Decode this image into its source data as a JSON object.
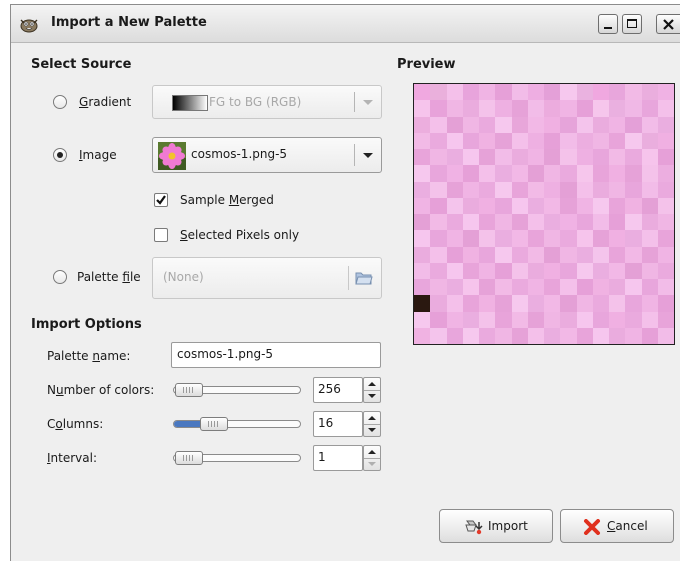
{
  "window": {
    "title": "Import a New Palette"
  },
  "sections": {
    "select_source": "Select Source",
    "preview": "Preview",
    "import_options": "Import Options"
  },
  "source": {
    "gradient": {
      "label_pre": "",
      "label_mn": "G",
      "label_post": "radient",
      "selected": false,
      "combo_value": "FG to BG (RGB)"
    },
    "image": {
      "label_pre": "",
      "label_mn": "I",
      "label_post": "mage",
      "selected": true,
      "combo_value": "cosmos-1.png-5"
    },
    "sample_merged": {
      "label_pre": "Sample ",
      "label_mn": "M",
      "label_post": "erged",
      "checked": true
    },
    "selected_pixels": {
      "label_pre": "",
      "label_mn": "S",
      "label_post": "elected Pixels only",
      "checked": false
    },
    "palette_file": {
      "label_pre": "Palette ",
      "label_mn": "f",
      "label_post": "ile",
      "selected": false,
      "value": "(None)"
    }
  },
  "options": {
    "palette_name": {
      "label_pre": "Palette ",
      "label_mn": "n",
      "label_post": "ame:",
      "value": "cosmos-1.png-5"
    },
    "num_colors": {
      "label_pre": "N",
      "label_mn": "u",
      "label_post": "mber of colors:",
      "value": "256",
      "level": 0.0
    },
    "columns": {
      "label_pre": "C",
      "label_mn": "o",
      "label_post": "lumns:",
      "value": "16",
      "level": 0.25
    },
    "interval": {
      "label_pre": "",
      "label_mn": "I",
      "label_post": "nterval:",
      "value": "1",
      "level": 0.0
    }
  },
  "buttons": {
    "import": "Import",
    "cancel_mn": "C",
    "cancel_post": "ancel"
  },
  "preview_colors": [
    "#f0a8e0",
    "#eab0dc",
    "#f4c0ea",
    "#e8a4dc",
    "#f0b4e4",
    "#e6a0d8",
    "#f2bce8",
    "#eeaee2",
    "#e4a0d8",
    "#f6c8ee",
    "#eab2e0",
    "#f0a8e0",
    "#e8a6dc",
    "#f2bae6",
    "#eaaede",
    "#f0b2e4",
    "#f6c4ec",
    "#e8a2da",
    "#f0b6e4",
    "#eaacde",
    "#f4c2ea",
    "#eeb0e2",
    "#e6a2d8",
    "#f2bce8",
    "#ecacde",
    "#f0b4e4",
    "#e6a0d8",
    "#f6c6ec",
    "#eab0e0",
    "#f0b8e6",
    "#e8a6dc",
    "#f4c0ea",
    "#ecaede",
    "#f4c0ea",
    "#e4a0d6",
    "#f0b6e4",
    "#eaaade",
    "#f6c8ee",
    "#e8a6da",
    "#f2b8e6",
    "#f0b0e2",
    "#e6a4da",
    "#f4c4ec",
    "#eaacde",
    "#f0b4e4",
    "#e4a0d8",
    "#f2bce8",
    "#eaaee0",
    "#f2bae6",
    "#eaaade",
    "#f6c6ee",
    "#e8a6dc",
    "#f0b2e2",
    "#e6a2d8",
    "#f4c0ea",
    "#eeb0e2",
    "#e6a0d8",
    "#f2bce8",
    "#ecaee0",
    "#f0b6e4",
    "#e8a4da",
    "#f6c8ee",
    "#eaaede",
    "#f0b0e2",
    "#e8a4da",
    "#f0b6e4",
    "#eaaee0",
    "#f6c6ee",
    "#e6a2d8",
    "#f2bce8",
    "#eaacde",
    "#f0b4e4",
    "#e4a0d6",
    "#f4c2ea",
    "#eeb0e2",
    "#e8a6dc",
    "#f2bae6",
    "#eaaade",
    "#f6c4ec",
    "#e6a0d8",
    "#f6c8ee",
    "#e8a6dc",
    "#f0b2e4",
    "#e6a0d8",
    "#f4c0ea",
    "#eaaee0",
    "#f2b8e6",
    "#e4a0d6",
    "#f0b6e4",
    "#eaaade",
    "#f6c6ec",
    "#e8a4da",
    "#f0b0e2",
    "#e6a2d8",
    "#f4c2ea",
    "#ecaee0",
    "#eaaee0",
    "#f4c2ea",
    "#e6a2d8",
    "#f0b4e4",
    "#eaaade",
    "#f6c8ee",
    "#e8a4da",
    "#f2bae6",
    "#eeb0e2",
    "#e4a0d6",
    "#f4c0ea",
    "#eaacde",
    "#f0b6e4",
    "#e8a6dc",
    "#f2bce8",
    "#eaaade",
    "#f0b4e4",
    "#e6a0d8",
    "#f4c4ec",
    "#eaacde",
    "#f0b0e2",
    "#e8a6dc",
    "#f6c6ee",
    "#eaaee0",
    "#f2b8e6",
    "#e6a2d8",
    "#f0b4e4",
    "#f6c8ee",
    "#e8a4da",
    "#f0b2e2",
    "#e4a0d6",
    "#f4c2ea",
    "#e4a0d6",
    "#f2bae6",
    "#eaaade",
    "#f6c6ee",
    "#e8a4da",
    "#f0b6e4",
    "#e6a2d8",
    "#f4c0ea",
    "#eaaee0",
    "#f0b2e4",
    "#e8a6dc",
    "#f2bce8",
    "#e6a0d8",
    "#f6c8ee",
    "#eaacde",
    "#f0b6e4",
    "#f6c6ee",
    "#e8a6dc",
    "#f0b4e4",
    "#e4a0d6",
    "#f4c2ea",
    "#eaaee0",
    "#f2b8e6",
    "#e8a4da",
    "#f0b6e4",
    "#eaaade",
    "#f6c4ec",
    "#e6a2d8",
    "#f0b0e2",
    "#eaaee0",
    "#f4c0ea",
    "#e8a4da",
    "#eaacde",
    "#f4c0ea",
    "#e6a0d8",
    "#f0b2e2",
    "#e8a6dc",
    "#f6c8ee",
    "#eaaade",
    "#f2bae6",
    "#e4a0d6",
    "#f0b6e4",
    "#eaaee0",
    "#f4c4ec",
    "#e8a4da",
    "#f2b8e6",
    "#e6a2d8",
    "#f0b4e4",
    "#f2bce8",
    "#eaaade",
    "#f6c6ee",
    "#e8a4da",
    "#f0b4e4",
    "#e6a0d8",
    "#f4c2ea",
    "#eaacde",
    "#f0b0e2",
    "#e8a6dc",
    "#f6c8ee",
    "#eaaee0",
    "#f2b8e6",
    "#e4a0d6",
    "#f0b6e4",
    "#eaaade",
    "#e8a6dc",
    "#f0b6e4",
    "#eaaee0",
    "#f6c4ec",
    "#e6a2d8",
    "#f2bae6",
    "#eaaade",
    "#f0b4e4",
    "#e8a4da",
    "#f4c0ea",
    "#e6a0d8",
    "#f0b2e2",
    "#eaacde",
    "#f6c6ee",
    "#e8a6dc",
    "#f2bce8",
    "#2a1810",
    "#eaacde",
    "#f4c0ea",
    "#e8a4da",
    "#f0b2e2",
    "#e6a2d8",
    "#f6c8ee",
    "#eaaee0",
    "#f2b8e6",
    "#e4a0d6",
    "#f0b6e4",
    "#eaaade",
    "#f4c2ea",
    "#e8a6dc",
    "#f0b4e4",
    "#e6a0d8",
    "#f6c8ee",
    "#e6a0d8",
    "#f0b4e4",
    "#eaaee0",
    "#f4c2ea",
    "#e8a4da",
    "#f2bae6",
    "#e6a2d8",
    "#f0b6e4",
    "#eaacde",
    "#f6c6ee",
    "#e8a6dc",
    "#f0b0e2",
    "#eaaade",
    "#f4c0ea",
    "#e8a4da",
    "#f0b2e2",
    "#f4c4ec",
    "#e8a6dc",
    "#f6c8ee",
    "#eaaade",
    "#f0b6e4",
    "#e6a2d8",
    "#f4c0ea",
    "#eaaee0",
    "#f2b8e6",
    "#e8a4da",
    "#f6c6ee",
    "#eaacde",
    "#f0b4e4",
    "#e6a0d8",
    "#f2bce8"
  ]
}
